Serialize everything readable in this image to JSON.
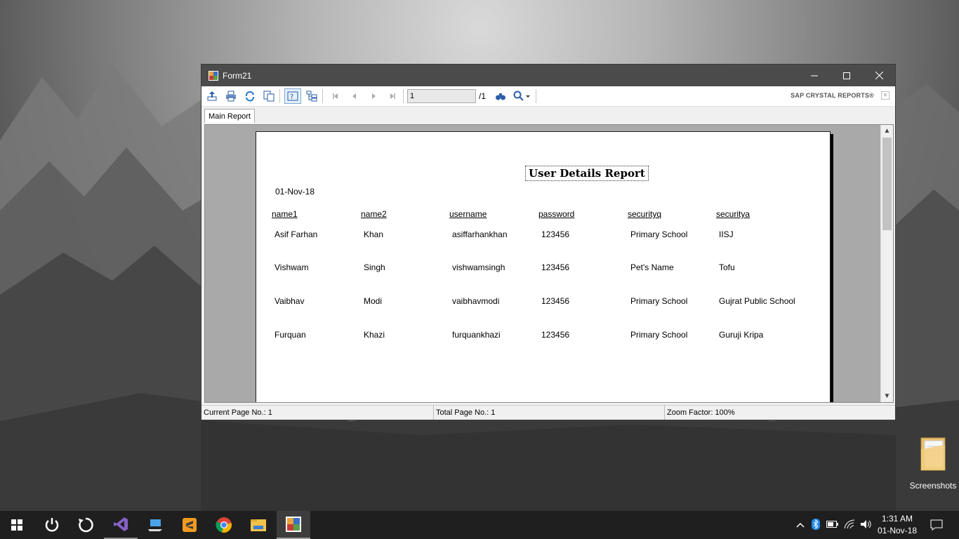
{
  "window": {
    "title": "Form21",
    "caption": {
      "minimize": "—",
      "maximize": "☐",
      "close": "✕"
    }
  },
  "toolbar": {
    "icons": [
      "export-icon",
      "print-icon",
      "refresh-icon",
      "copy-icon",
      "help-icon",
      "group-tree-icon",
      "first-page-icon",
      "prev-page-icon",
      "next-page-icon",
      "last-page-icon",
      "find-icon",
      "zoom-icon"
    ],
    "page_value": "1",
    "page_total": "/1",
    "brand": "SAP CRYSTAL REPORTS®"
  },
  "tabs": {
    "main": "Main Report"
  },
  "report": {
    "title": "User Details Report",
    "date": "01-Nov-18",
    "headers": [
      "name1",
      "name2",
      "username",
      "password",
      "securityq",
      "securitya"
    ],
    "rows": [
      [
        "Asif Farhan",
        "Khan",
        "asiffarhankhan",
        "123456",
        "Primary School",
        "IISJ"
      ],
      [
        "Vishwam",
        "Singh",
        "vishwamsingh",
        "123456",
        "Pet's Name",
        "Tofu"
      ],
      [
        "Vaibhav",
        "Modi",
        "vaibhavmodi",
        "123456",
        "Primary School",
        "Gujrat Public School"
      ],
      [
        "Furquan",
        "Khazi",
        "furquankhazi",
        "123456",
        "Primary School",
        "Guruji Kripa"
      ]
    ]
  },
  "statusbar": {
    "current_page": "Current Page No.: 1",
    "total_page": "Total Page No.: 1",
    "zoom": "Zoom Factor: 100%"
  },
  "desktop": {
    "folder_label": "Screenshots"
  },
  "taskbar": {
    "clock_time": "1:31 AM",
    "clock_date": "01-Nov-18",
    "apps": [
      "windows-start-icon",
      "power-icon",
      "restart-icon",
      "visual-studio-icon",
      "remote-desktop-icon",
      "sublime-text-icon",
      "chrome-icon",
      "file-explorer-icon",
      "form21-app-icon"
    ]
  },
  "colors": {
    "titlebar": "#4b4b4b",
    "taskbar": "#1f1f1f",
    "viewer_bg": "#a9a9a9"
  }
}
